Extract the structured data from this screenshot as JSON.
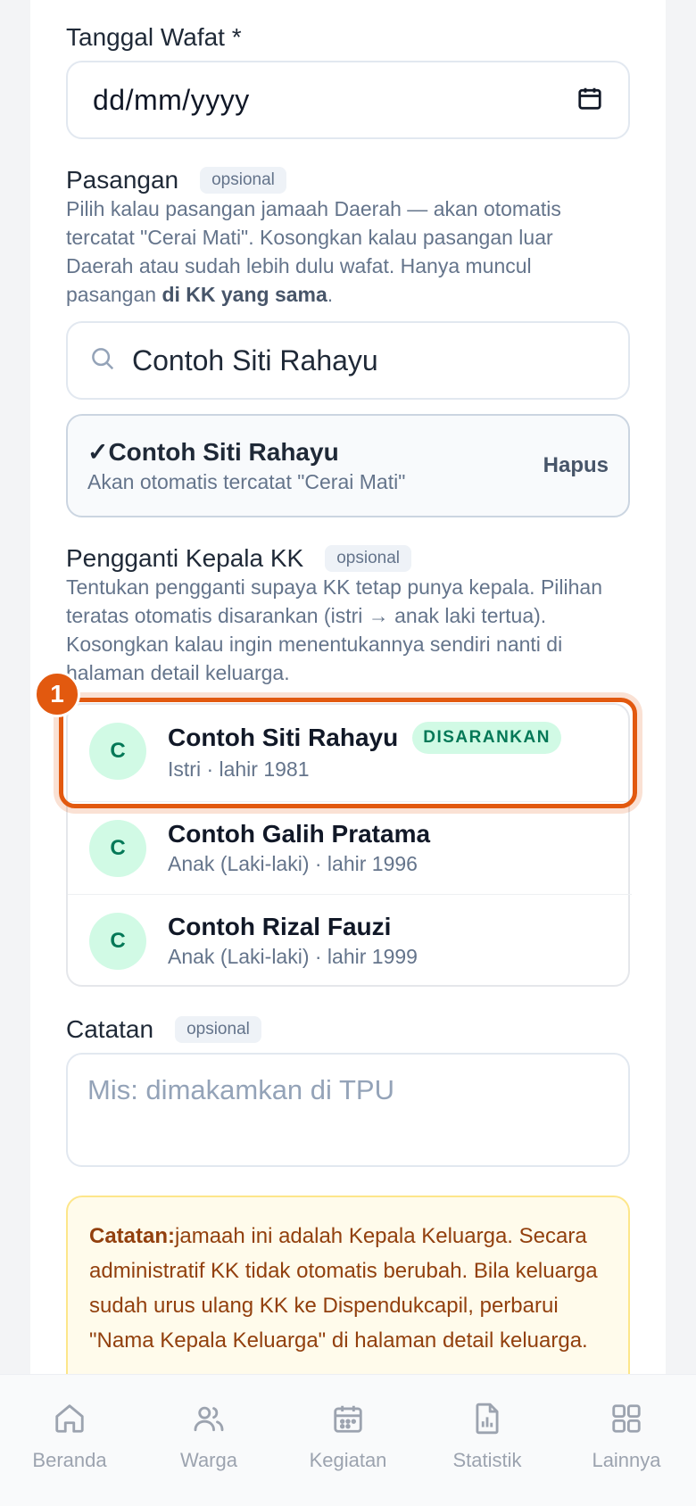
{
  "death_date": {
    "label": "Tanggal Wafat *",
    "value": "dd/mm/yyyy",
    "icon": "calendar-icon"
  },
  "spouse": {
    "label": "Pasangan",
    "optional_chip": "opsional",
    "description_1": "Pilih kalau pasangan jamaah Daerah — akan otomatis tercatat \"Cerai Mati\". Kosongkan kalau pasangan luar Daerah atau sudah lebih dulu wafat. Hanya muncul pasangan ",
    "description_bold": "di KK yang sama",
    "description_2": ".",
    "search_value": "Contoh Siti Rahayu",
    "selected_name": "✓Contoh Siti Rahayu",
    "selected_sub": "Akan otomatis tercatat \"Cerai Mati\"",
    "remove_label": "Hapus"
  },
  "replacement": {
    "label": "Pengganti Kepala KK",
    "optional_chip": "opsional",
    "description": "Tentukan pengganti supaya KK tetap punya kepala. Pilihan teratas otomatis disarankan (istri → anak laki tertua). Kosongkan kalau ingin menentukannya sendiri nanti di halaman detail keluarga.",
    "step_number": "1",
    "candidates": [
      {
        "initial": "C",
        "name": "Contoh Siti Rahayu",
        "badge": "DISARANKAN",
        "sub": "Istri · lahir 1981"
      },
      {
        "initial": "C",
        "name": "Contoh Galih Pratama",
        "badge": "",
        "sub": "Anak (Laki-laki) · lahir 1996"
      },
      {
        "initial": "C",
        "name": "Contoh Rizal Fauzi",
        "badge": "",
        "sub": "Anak (Laki-laki) · lahir 1999"
      }
    ]
  },
  "notes": {
    "label": "Catatan",
    "optional_chip": "opsional",
    "placeholder": "Mis: dimakamkan di TPU"
  },
  "warning": {
    "title": "Catatan:",
    "text": "jamaah ini adalah Kepala Keluarga. Secara administratif KK tidak otomatis berubah. Bila keluarga sudah urus ulang KK ke Dispendukcapil, perbarui \"Nama Kepala Keluarga\" di halaman detail keluarga."
  },
  "nav": {
    "items": [
      {
        "label": "Beranda",
        "icon": "home-icon"
      },
      {
        "label": "Warga",
        "icon": "users-icon"
      },
      {
        "label": "Kegiatan",
        "icon": "calendar-icon"
      },
      {
        "label": "Statistik",
        "icon": "chart-icon"
      },
      {
        "label": "Lainnya",
        "icon": "grid-icon"
      }
    ]
  }
}
